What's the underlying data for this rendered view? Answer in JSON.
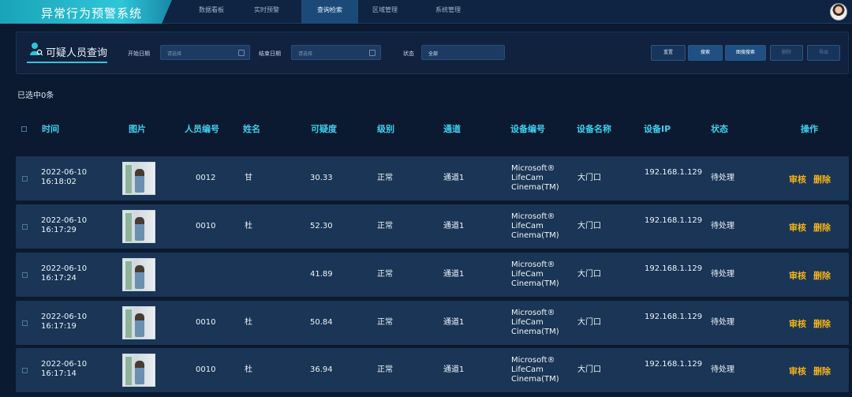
{
  "app": {
    "title": "异常行为预警系统"
  },
  "nav": {
    "tabs": [
      {
        "label": "数据看板"
      },
      {
        "label": "实时预警"
      },
      {
        "label": "查询检索",
        "active": true
      },
      {
        "label": "区域管理"
      },
      {
        "label": "系统管理"
      }
    ]
  },
  "filter": {
    "panel_title": "可疑人员查询",
    "start_label": "开始日期",
    "start_placeholder": "请选择",
    "end_label": "结束日期",
    "end_placeholder": "请选择",
    "status_label": "状态",
    "status_value": "全部",
    "buttons": {
      "reset": "重置",
      "search": "搜索",
      "image_search": "图搜搜索",
      "delete": "删除",
      "export": "导出"
    }
  },
  "selection": {
    "text": "已选中0条"
  },
  "table": {
    "headers": {
      "time": "时间",
      "image": "图片",
      "person_id": "人员编号",
      "name": "姓名",
      "suspicion": "可疑度",
      "level": "级别",
      "channel": "通道",
      "device_id": "设备编号",
      "device_name": "设备名称",
      "device_ip": "设备IP",
      "status": "状态",
      "actions": "操作"
    },
    "rows": [
      {
        "time": "2022-06-10 16:18:02",
        "person_id": "0012",
        "name": "甘",
        "suspicion": "30.33",
        "level": "正常",
        "channel": "通道1",
        "device_id": "Microsoft® LifeCam Cinema(TM)",
        "device_name": "大门口",
        "device_ip": "192.168.1.129",
        "status": "待处理",
        "review": "审核",
        "delete": "删除"
      },
      {
        "time": "2022-06-10 16:17:29",
        "person_id": "0010",
        "name": "杜",
        "suspicion": "52.30",
        "level": "正常",
        "channel": "通道1",
        "device_id": "Microsoft® LifeCam Cinema(TM)",
        "device_name": "大门口",
        "device_ip": "192.168.1.129",
        "status": "待处理",
        "review": "审核",
        "delete": "删除"
      },
      {
        "time": "2022-06-10 16:17:24",
        "person_id": "",
        "name": "",
        "suspicion": "41.89",
        "level": "正常",
        "channel": "通道1",
        "device_id": "Microsoft® LifeCam Cinema(TM)",
        "device_name": "大门口",
        "device_ip": "192.168.1.129",
        "status": "待处理",
        "review": "审核",
        "delete": "删除"
      },
      {
        "time": "2022-06-10 16:17:19",
        "person_id": "0010",
        "name": "杜",
        "suspicion": "50.84",
        "level": "正常",
        "channel": "通道1",
        "device_id": "Microsoft® LifeCam Cinema(TM)",
        "device_name": "大门口",
        "device_ip": "192.168.1.129",
        "status": "待处理",
        "review": "审核",
        "delete": "删除"
      },
      {
        "time": "2022-06-10 16:17:14",
        "person_id": "0010",
        "name": "杜",
        "suspicion": "36.94",
        "level": "正常",
        "channel": "通道1",
        "device_id": "Microsoft® LifeCam Cinema(TM)",
        "device_name": "大门口",
        "device_ip": "192.168.1.129",
        "status": "待处理",
        "review": "审核",
        "delete": "删除"
      }
    ]
  },
  "colors": {
    "accent": "#2fc6d9",
    "header_text": "#3fd0f0",
    "action_text": "#f2b31a",
    "background": "#0b1a30"
  },
  "icons": {
    "panel": "user-search-icon",
    "calendar": "calendar-icon",
    "avatar": "user-avatar"
  }
}
